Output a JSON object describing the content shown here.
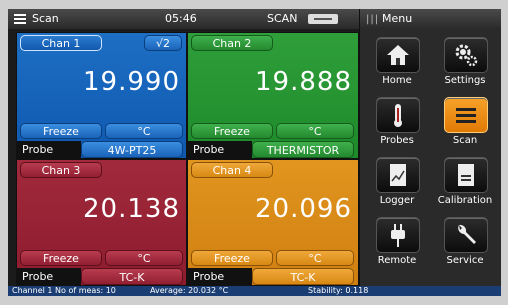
{
  "topbar": {
    "left_label": "Scan",
    "time": "05:46",
    "mode": "SCAN"
  },
  "menu": {
    "title": "Menu",
    "items": [
      {
        "label": "Home",
        "icon": "home-icon"
      },
      {
        "label": "Settings",
        "icon": "gears-icon"
      },
      {
        "label": "Probes",
        "icon": "probe-icon"
      },
      {
        "label": "Scan",
        "icon": "scan-list-icon"
      },
      {
        "label": "Logger",
        "icon": "logger-icon"
      },
      {
        "label": "Calibration",
        "icon": "calibration-icon"
      },
      {
        "label": "Remote",
        "icon": "remote-plug-icon"
      },
      {
        "label": "Service",
        "icon": "wrench-icon"
      }
    ]
  },
  "channels": [
    {
      "name": "Chan 1",
      "sqrt": "√2",
      "value": "19.990",
      "freeze": "Freeze",
      "unit": "°C",
      "probe_label": "Probe",
      "probe": "4W-PT25",
      "color": "#1566bd"
    },
    {
      "name": "Chan 2",
      "value": "19.888",
      "freeze": "Freeze",
      "unit": "°C",
      "probe_label": "Probe",
      "probe": "THERMISTOR",
      "color": "#27962f"
    },
    {
      "name": "Chan 3",
      "value": "20.138",
      "freeze": "Freeze",
      "unit": "°C",
      "probe_label": "Probe",
      "probe": "TC-K",
      "color": "#9a2536"
    },
    {
      "name": "Chan 4",
      "value": "20.096",
      "freeze": "Freeze",
      "unit": "°C",
      "probe_label": "Probe",
      "probe": "TC-K",
      "color": "#dc8c18"
    }
  ],
  "status": {
    "left": "Channel 1 No of meas: 10",
    "mid": "Average: 20.032 °C",
    "right": "Stability: 0.118"
  },
  "colors": {
    "active_menu": "#f08f14",
    "status_bar": "#1a3e74"
  }
}
